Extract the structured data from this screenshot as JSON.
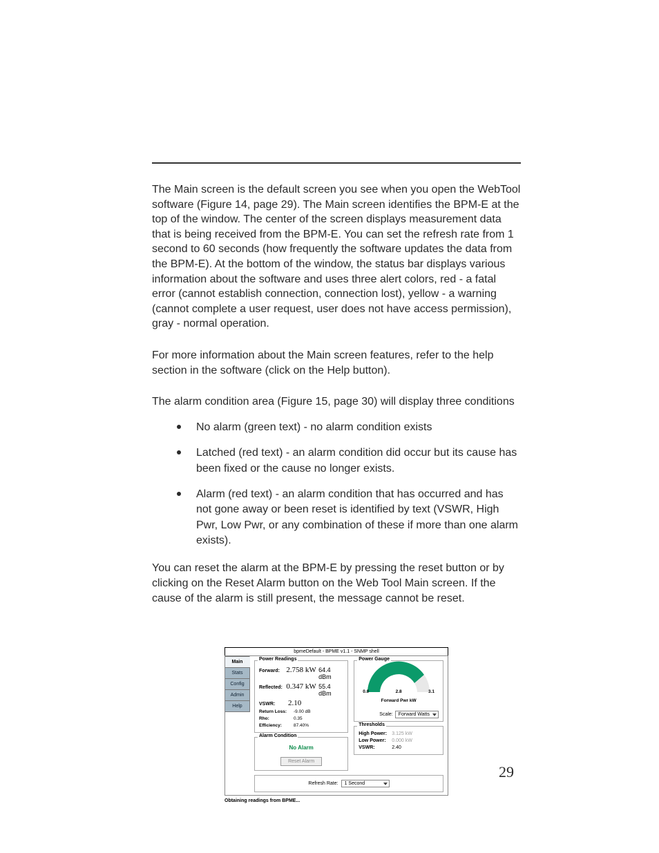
{
  "body": {
    "para1": "The Main screen is the default screen you see when you open the WebTool soft­ware (Figure 14, page 29). The Main screen identifies the BPM-E at the top of the window. The center of the screen displays measurement data that is being received from the BPM-E. You can set the refresh rate from 1 second to 60 sec­onds (how frequently the software updates the data from the BPM-E). At the bottom of the window, the status bar displays various information about the software and uses three alert colors, red - a fatal error (cannot establish connec­tion, connection lost), yellow - a warning (cannot complete a user request, user does not have access permission), gray - normal operation.",
    "para2": "For more information about the Main screen features, refer to the help section in the software (click on the Help button).",
    "para3": "The alarm condition area (Figure 15, page 30) will display three conditions",
    "bullets": [
      "No alarm (green text) - no alarm condition exists",
      "Latched (red text) - an alarm condition did occur but its cause has been fixed or the cause no longer exists.",
      "Alarm (red text) - an alarm condition that has occurred and has not gone away or been reset is identified by text (VSWR, High Pwr, Low Pwr, or any combination of these if more than one alarm exists)."
    ],
    "para4": "You can reset the alarm at the BPM-E by pressing the reset button or by clicking on the Reset Alarm button on the Web Tool Main screen. If the cause of the alarm is still present, the message cannot be reset."
  },
  "fig": {
    "title": "bpmeDefault - BPME v1.1 - SNMP shell",
    "tabs": [
      "Main",
      "Stats",
      "Config",
      "Admin",
      "Help"
    ],
    "readings": {
      "title": "Power Readings",
      "forward_label": "Forward:",
      "forward_val": "2.758 kW",
      "forward_db": "64.4 dBm",
      "reflected_label": "Reflected:",
      "reflected_val": "0.347 kW",
      "reflected_db": "55.4 dBm",
      "vswr_label": "VSWR:",
      "vswr_val": "2.10",
      "rloss_label": "Return Loss:",
      "rloss_val": "-9.00 dB",
      "rho_label": "Rho:",
      "rho_val": "0.35",
      "eff_label": "Efficiency:",
      "eff_val": "87.40%"
    },
    "alarm": {
      "title": "Alarm Condition",
      "status": "No Alarm",
      "reset": "Reset Alarm"
    },
    "gauge": {
      "title": "Power Gauge",
      "tick0": "0.0",
      "tick1": "2.8",
      "tick2": "3.1",
      "axis": "Forward Pwr kW",
      "scale_label": "Scale:",
      "scale_value": "Forward Watts"
    },
    "thresholds": {
      "title": "Thresholds",
      "hp_label": "High Power:",
      "hp_val": "3.125 kW",
      "lp_label": "Low Power:",
      "lp_val": "0.000 kW",
      "vswr_label": "VSWR:",
      "vswr_val": "2.40"
    },
    "refresh": {
      "label": "Refresh Rate:",
      "value": "1 Second"
    },
    "status": "Obtaining readings from BPME..."
  },
  "page_number": "29",
  "chart_data": {
    "type": "bar",
    "title": "Forward Pwr kW",
    "categories": [
      "Forward Pwr kW"
    ],
    "values": [
      2.758
    ],
    "xlabel": "",
    "ylabel": "kW",
    "ylim": [
      0.0,
      3.1
    ],
    "ticks": [
      0.0,
      2.8,
      3.1
    ]
  }
}
